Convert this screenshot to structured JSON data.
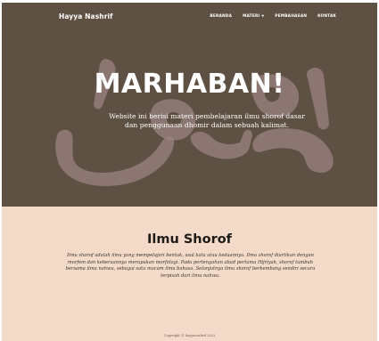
{
  "brand": "Hayya Nashrif",
  "nav": {
    "items": [
      {
        "label": "BERANDA"
      },
      {
        "label": "MATERI"
      },
      {
        "label": "PEMBAHASAN"
      },
      {
        "label": "KONTAK"
      }
    ]
  },
  "hero": {
    "title": "MARHABAN!",
    "subtitle": "Website ini berisi materi pembelajaran ilmu shorof dasar dan penggunaan dhomir dalam sebuah kalimat."
  },
  "section": {
    "title": "Ilmu Shorof",
    "body": "Ilmu shorof adalah ilmu yang mempelajari bentuk, asal kata atau kedaannya. Ilmu shorof diartikan dengan morfem dan keberaannya merupakan morfologi. Pada pertengahan abad pertama Hijriyah, shorof tumbuh bersama ilmu nahwu, sebagai satu macam ilmu bahasa. Selanjutnya ilmu shorof berkembang sendiri secara terpisah dari ilmu nahwu."
  },
  "footer": {
    "text": "Copyright © hayyanashrif 2022"
  },
  "colors": {
    "hero_bg": "#5e5043",
    "content_bg": "#f4dac9",
    "watermark": "#b49a9a"
  },
  "icons": {
    "dropdown": "chevron-down-icon"
  }
}
